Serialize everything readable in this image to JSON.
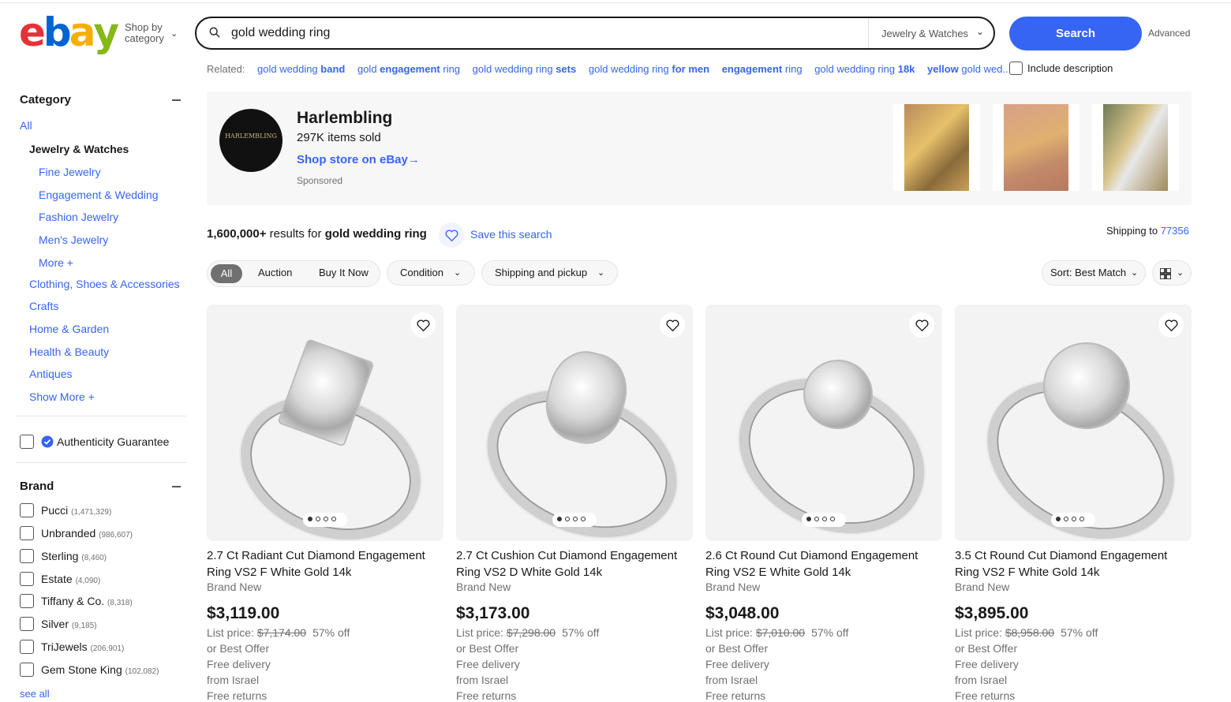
{
  "header": {
    "logo_letters": [
      "e",
      "b",
      "a",
      "y"
    ],
    "logo_colors": [
      "#e53238",
      "#0064d2",
      "#f5af02",
      "#86b817"
    ],
    "shop_by_line1": "Shop by",
    "shop_by_line2": "category",
    "search_value": "gold wedding ring",
    "category_select": "Jewelry & Watches",
    "search_button": "Search",
    "advanced": "Advanced"
  },
  "related": {
    "label": "Related:",
    "links": [
      {
        "pre": "gold wedding ",
        "bold": "band"
      },
      {
        "pre": "gold ",
        "bold": "engagement",
        "post": " ring"
      },
      {
        "pre": "gold wedding ring ",
        "bold": "sets"
      },
      {
        "pre": "gold wedding ring ",
        "bold": "for men"
      },
      {
        "bold": "engagement",
        "post": " ring"
      },
      {
        "pre": "gold wedding ring ",
        "bold": "18k"
      },
      {
        "bold": "yellow",
        "post": " gold wed..."
      }
    ],
    "include_description": "Include description"
  },
  "sidebar": {
    "category_title": "Category",
    "all": "All",
    "jewelry": "Jewelry & Watches",
    "sub": [
      "Fine Jewelry",
      "Engagement & Wedding",
      "Fashion Jewelry",
      "Men's Jewelry",
      "More +"
    ],
    "top": [
      "Clothing, Shoes & Accessories",
      "Crafts",
      "Home & Garden",
      "Health & Beauty",
      "Antiques",
      "Show More +"
    ],
    "authenticity": "Authenticity Guarantee",
    "brand_title": "Brand",
    "brands": [
      {
        "name": "Pucci",
        "count": "(1,471,329)"
      },
      {
        "name": "Unbranded",
        "count": "(986,607)"
      },
      {
        "name": "Sterling",
        "count": "(8,460)"
      },
      {
        "name": "Estate",
        "count": "(4,090)"
      },
      {
        "name": "Tiffany & Co.",
        "count": "(8,318)"
      },
      {
        "name": "Silver",
        "count": "(9,185)"
      },
      {
        "name": "TriJewels",
        "count": "(206,901)"
      },
      {
        "name": "Gem Stone King",
        "count": "(102,082)"
      }
    ],
    "see_all": "see all"
  },
  "store": {
    "logo_text": "HARLEMBLING",
    "name": "Harlembling",
    "sold": "297K items sold",
    "link": "Shop store on eBay",
    "sponsored": "Sponsored"
  },
  "results": {
    "count": "1,600,000+",
    "for_text": " results for ",
    "query": "gold wedding ring",
    "save": "Save this search",
    "shipping_label": "Shipping to",
    "zip": "77356"
  },
  "filters": {
    "all": "All",
    "auction": "Auction",
    "buy_it_now": "Buy It Now",
    "condition": "Condition",
    "shipping": "Shipping and pickup",
    "sort": "Sort: Best Match"
  },
  "products": [
    {
      "title": "2.7 Ct Radiant Cut Diamond Engagement Ring VS2 F White Gold 14k",
      "condition": "Brand New",
      "price": "$3,119.00",
      "list_label": "List price:",
      "list_price": "$7,174.00",
      "off": "57% off",
      "offer": "or Best Offer",
      "delivery": "Free delivery",
      "from": "from Israel",
      "returns": "Free returns"
    },
    {
      "title": "2.7 Ct Cushion Cut Diamond Engagement Ring VS2 D White Gold 14k",
      "condition": "Brand New",
      "price": "$3,173.00",
      "list_label": "List price:",
      "list_price": "$7,298.00",
      "off": "57% off",
      "offer": "or Best Offer",
      "delivery": "Free delivery",
      "from": "from Israel",
      "returns": "Free returns"
    },
    {
      "title": "2.6 Ct Round Cut Diamond Engagement Ring VS2 E White Gold 14k",
      "condition": "Brand New",
      "price": "$3,048.00",
      "list_label": "List price:",
      "list_price": "$7,010.00",
      "off": "57% off",
      "offer": "or Best Offer",
      "delivery": "Free delivery",
      "from": "from Israel",
      "returns": "Free returns"
    },
    {
      "title": "3.5 Ct Round Cut Diamond Engagement Ring VS2 F White Gold 14k",
      "condition": "Brand New",
      "price": "$3,895.00",
      "list_label": "List price:",
      "list_price": "$8,958.00",
      "off": "57% off",
      "offer": "or Best Offer",
      "delivery": "Free delivery",
      "from": "from Israel",
      "returns": "Free returns"
    }
  ]
}
